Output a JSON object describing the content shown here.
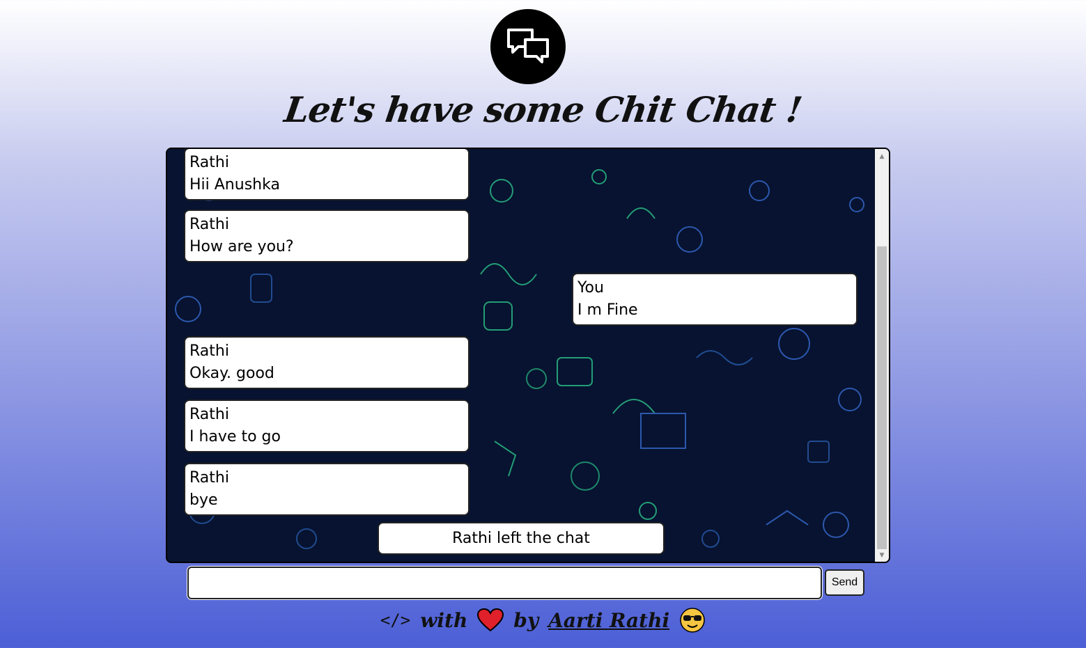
{
  "header": {
    "logo_icon": "chat-bubbles-icon",
    "title": "Let's have some Chit Chat !"
  },
  "messages": [
    {
      "sender": "Rathi",
      "text": "Hii Anushka",
      "side": "left"
    },
    {
      "sender": "Rathi",
      "text": "How are you?",
      "side": "left"
    },
    {
      "sender": "You",
      "text": "I m Fine",
      "side": "right"
    },
    {
      "sender": "Rathi",
      "text": "Okay. good",
      "side": "left"
    },
    {
      "sender": "Rathi",
      "text": "I have to go",
      "side": "left"
    },
    {
      "sender": "Rathi",
      "text": "bye",
      "side": "left"
    }
  ],
  "notice": "Rathi left the chat",
  "composer": {
    "input_value": "",
    "send_label": "Send"
  },
  "footer": {
    "code_symbol": "</>",
    "with": "with",
    "heart_icon": "heart-icon",
    "by": "by",
    "author": "Aarti Rathi",
    "emoji_icon": "sunglasses-face-icon"
  },
  "colors": {
    "chat_bg": "#071330",
    "accent_green": "#2ecc8f",
    "accent_blue": "#3a6fd8",
    "heart": "#e0202a"
  }
}
